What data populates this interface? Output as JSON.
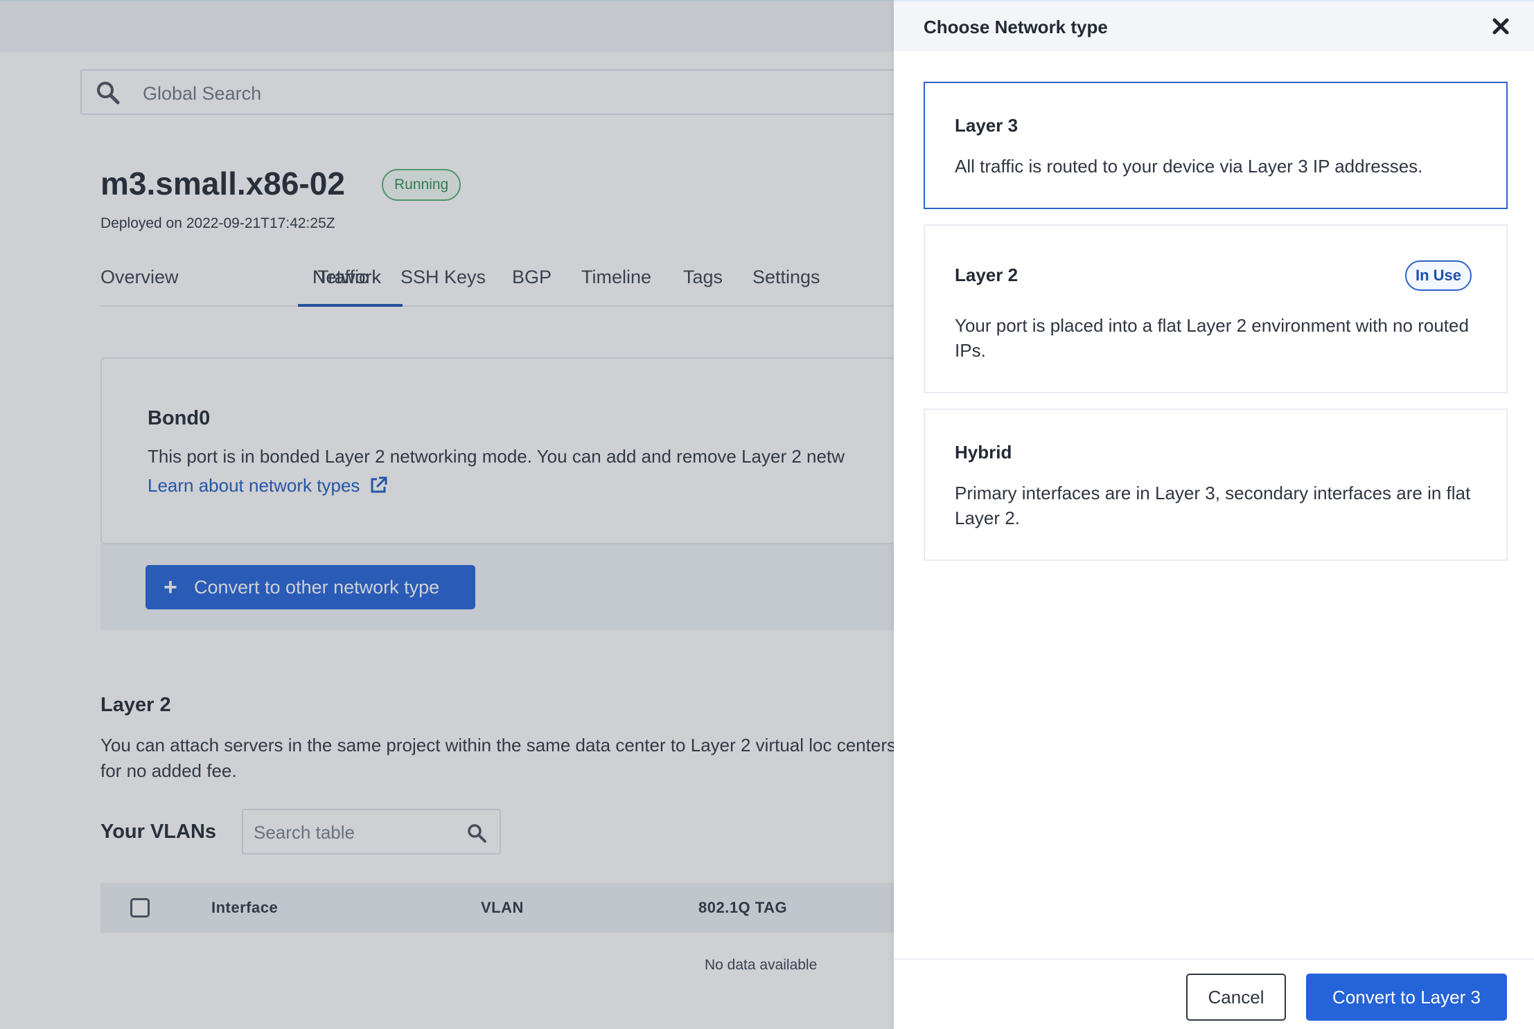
{
  "search": {
    "placeholder": "Global Search"
  },
  "device": {
    "name": "m3.small.x86-02",
    "status": "Running",
    "deployed": "Deployed on 2022-09-21T17:42:25Z"
  },
  "tabs": [
    {
      "label": "Overview"
    },
    {
      "label": "Network",
      "active": true
    },
    {
      "label": "Traffic"
    },
    {
      "label": "SSH Keys"
    },
    {
      "label": "BGP"
    },
    {
      "label": "Timeline"
    },
    {
      "label": "Tags"
    },
    {
      "label": "Settings"
    }
  ],
  "bond": {
    "title": "Bond0",
    "description": "This port is in bonded Layer 2 networking mode. You can add and remove Layer 2 netw",
    "link": "Learn about network types",
    "convert_button": "Convert to other network type"
  },
  "layer2": {
    "title": "Layer 2",
    "description": "You can attach servers in the same project within the same data center to Layer 2 virtual loc centers for no added fee."
  },
  "vlans": {
    "title": "Your VLANs",
    "search_placeholder": "Search table",
    "columns": [
      "Interface",
      "VLAN",
      "802.1Q TAG"
    ],
    "empty": "No data available"
  },
  "drawer": {
    "title": "Choose Network type",
    "options": [
      {
        "title": "Layer 3",
        "description": "All traffic is routed to your device via Layer 3 IP addresses.",
        "selected": true
      },
      {
        "title": "Layer 2",
        "description": "Your port is placed into a flat Layer 2 environment with no routed IPs.",
        "badge": "In Use"
      },
      {
        "title": "Hybrid",
        "description": "Primary interfaces are in Layer 3, secondary interfaces are in flat Layer 2."
      }
    ],
    "cancel_label": "Cancel",
    "confirm_label": "Convert to Layer 3"
  },
  "colors": {
    "accent": "#2563d8",
    "running": "#58b27a",
    "in_use": "#2e63c6"
  }
}
